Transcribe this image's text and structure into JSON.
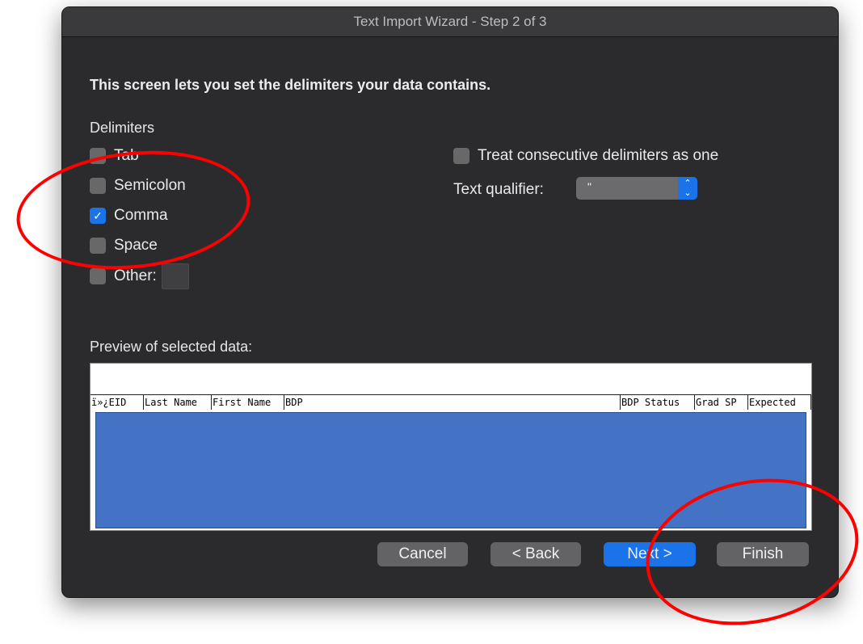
{
  "window": {
    "title": "Text Import Wizard - Step 2 of 3"
  },
  "heading": "This screen lets you set the delimiters your data contains.",
  "delimiters": {
    "label": "Delimiters",
    "items": [
      {
        "label": "Tab",
        "checked": false
      },
      {
        "label": "Semicolon",
        "checked": false
      },
      {
        "label": "Comma",
        "checked": true
      },
      {
        "label": "Space",
        "checked": false
      },
      {
        "label": "Other:",
        "checked": false
      }
    ]
  },
  "options": {
    "consecutive_label": "Treat consecutive delimiters as one",
    "text_qualifier_label": "Text qualifier:",
    "text_qualifier_value": "\""
  },
  "preview": {
    "label": "Preview of selected data:",
    "columns": [
      "ï»¿EID",
      "Last Name",
      "First Name",
      "BDP",
      "BDP Status",
      "Grad SP",
      "Expected"
    ]
  },
  "buttons": {
    "cancel": "Cancel",
    "back": "< Back",
    "next": "Next >",
    "finish": "Finish"
  },
  "colors": {
    "accent": "#1a73e8",
    "annotation": "#ff0000",
    "selection": "#4472c4"
  }
}
